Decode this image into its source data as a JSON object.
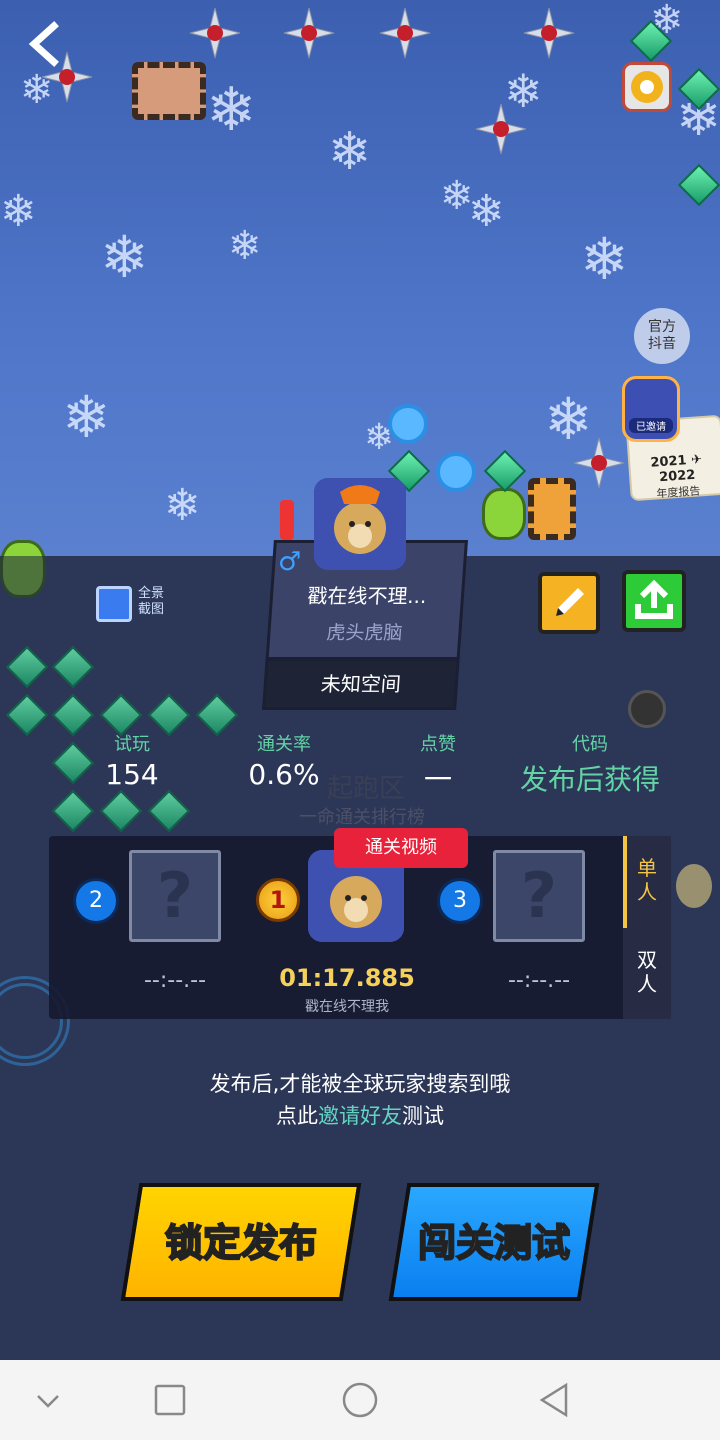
{
  "nav": {
    "back_icon": "chevron-left-icon",
    "settings_icon": "gear-icon"
  },
  "official": {
    "label_line1": "官方",
    "label_line2": "抖音"
  },
  "pass_card": {
    "badge": "已邀请",
    "year": "2021 ✈ 2022",
    "caption": "年度报告"
  },
  "screenshot": {
    "label_line1": "全景",
    "label_line2": "截图"
  },
  "author_card": {
    "name": "戳在线不理...",
    "tag": "虎头虎脑",
    "space": "未知空间",
    "gender_icon": "male-icon"
  },
  "stats": [
    {
      "label": "试玩",
      "value": "154"
    },
    {
      "label": "通关率",
      "value": "0.6%"
    },
    {
      "label": "点赞",
      "value": "一"
    },
    {
      "label": "代码",
      "value": "发布后获得"
    }
  ],
  "zone": {
    "title": "起跑区",
    "subtitle": "一命通关排行榜"
  },
  "ranking": {
    "video_tag": "通关视频",
    "entries": [
      {
        "rank": "2",
        "time": "--:--.--",
        "player": ""
      },
      {
        "rank": "1",
        "time": "01:17.885",
        "player": "戳在线不理我"
      },
      {
        "rank": "3",
        "time": "--:--.--",
        "player": ""
      }
    ],
    "tabs": {
      "single": "单人",
      "double": "双人"
    }
  },
  "hint": {
    "line1": "发布后,才能被全球玩家搜索到哦",
    "line2_prefix": "点此",
    "line2_link": "邀请好友",
    "line2_suffix": "测试"
  },
  "buttons": {
    "lock_publish": "锁定发布",
    "test_play": "闯关测试"
  },
  "colors": {
    "accent_green": "#63d3a6",
    "gold": "#f5d15a",
    "yellow_button": "#ffc400",
    "blue_button": "#1a95f8",
    "video_red": "#e7223a"
  }
}
